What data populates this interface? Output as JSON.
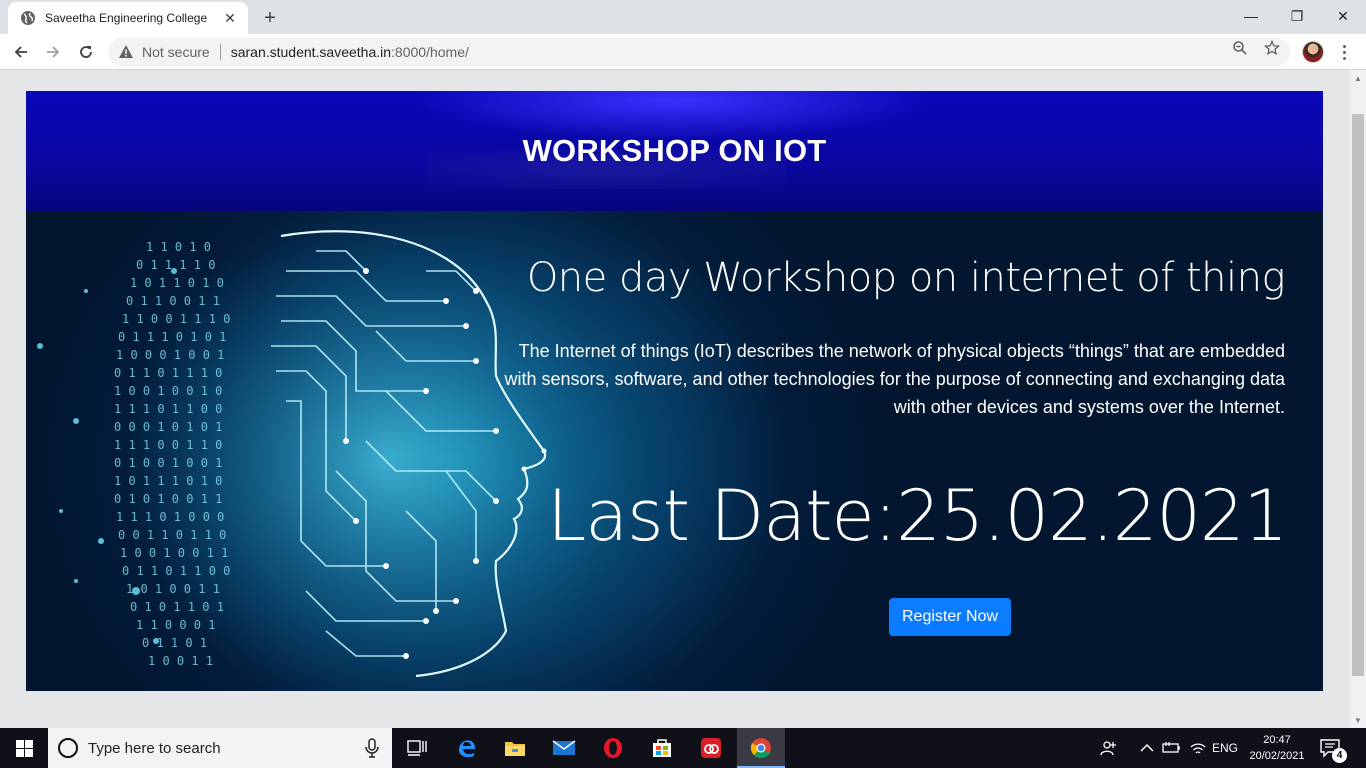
{
  "browser": {
    "tab_title": "Saveetha Engineering College",
    "tab_close": "✕",
    "new_tab": "+",
    "window_controls": {
      "minimize": "—",
      "restore": "❐",
      "close": "✕"
    },
    "security_label": "Not secure",
    "url_host": "saran.student.saveetha.in",
    "url_rest": ":8000/home/"
  },
  "page": {
    "banner_title": "WORKSHOP ON IOT",
    "hero_heading": "One day Workshop on internet of thing",
    "hero_description": "The Internet of things (IoT) describes the network of physical objects “things” that are embedded with sensors, software, and other technologies for the purpose of connecting and exchanging data with other devices and systems over the Internet.",
    "last_date": "Last Date:25.02.2021",
    "register_button": "Register Now"
  },
  "taskbar": {
    "search_placeholder": "Type here to search",
    "language": "ENG",
    "time": "20:47",
    "date": "20/02/2021",
    "notification_count": "4"
  },
  "colors": {
    "banner_blue": "#0a07b8",
    "hero_dark": "#021630",
    "button_blue": "#0b7cff"
  }
}
